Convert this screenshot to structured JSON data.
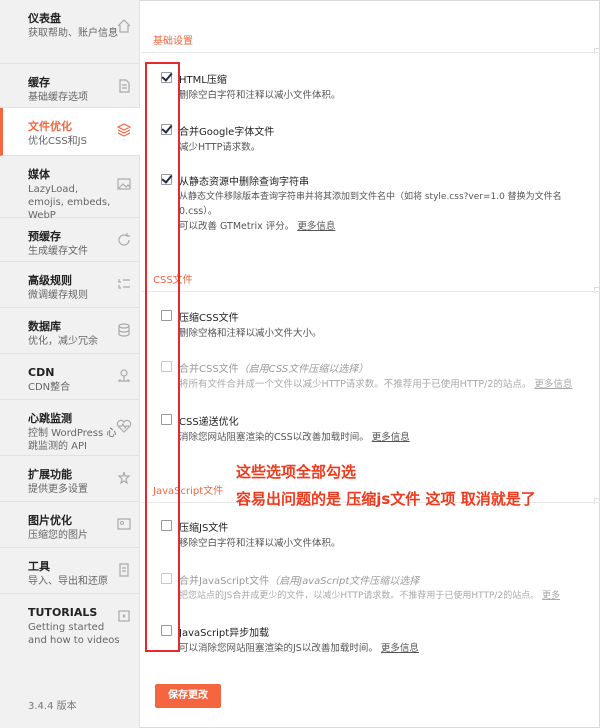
{
  "sidebar": {
    "items": [
      {
        "title": "仪表盘",
        "sub": "获取帮助、账户信息",
        "icon": "home-icon"
      },
      {
        "title": "缓存",
        "sub": "基础缓存选项",
        "icon": "page-icon"
      },
      {
        "title": "文件优化",
        "sub": "优化CSS和JS",
        "icon": "layers-icon",
        "active": true
      },
      {
        "title": "媒体",
        "sub": "LazyLoad, emojis, embeds, WebP",
        "icon": "image-icon"
      },
      {
        "title": "预缓存",
        "sub": "生成缓存文件",
        "icon": "refresh-icon"
      },
      {
        "title": "高级规则",
        "sub": "微调缓存规则",
        "icon": "list-icon"
      },
      {
        "title": "数据库",
        "sub": "优化，减少冗余",
        "icon": "database-icon"
      },
      {
        "title": "CDN",
        "sub": "CDN整合",
        "icon": "cdn-icon"
      },
      {
        "title": "心跳监测",
        "sub": "控制 WordPress 心跳监测的 API",
        "icon": "heart-icon"
      },
      {
        "title": "扩展功能",
        "sub": "提供更多设置",
        "icon": "addon-icon"
      },
      {
        "title": "图片优化",
        "sub": "压缩您的图片",
        "icon": "photo-icon"
      },
      {
        "title": "工具",
        "sub": "导入、导出和还原",
        "icon": "tools-icon"
      },
      {
        "title": "TUTORIALS",
        "sub": "Getting started and how to videos",
        "icon": "video-icon"
      }
    ],
    "version": "3.4.4 版本"
  },
  "sections": {
    "basic": "基础设置",
    "css": "CSS文件",
    "js": "JavaScript文件"
  },
  "options": {
    "html_minify": {
      "title": "HTML压缩",
      "desc": "删除空白字符和注释以减小文件体积。"
    },
    "google_fonts": {
      "title": "合并Google字体文件",
      "desc": "减少HTTP请求数。"
    },
    "query_strings": {
      "title": "从静态资源中删除查询字符串",
      "desc1": "从静态文件移除版本查询字符串并将其添加到文件名中（如将 style.css?ver=1.0 替换为文件名",
      "desc2": "0.css）。",
      "desc3": "可以改善 GTMetrix 评分。",
      "more": "更多信息"
    },
    "css_minify": {
      "title": "压缩CSS文件",
      "desc": "删除空格和注释以减小文件大小。"
    },
    "css_combine": {
      "title": "合并CSS文件",
      "hint": "（启用CSS文件压缩以选择）",
      "desc": "将所有文件合并成一个文件以减少HTTP请求数。不推荐用于已使用HTTP/2的站点。",
      "more": "更多信息"
    },
    "css_async": {
      "title": "CSS递送优化",
      "desc": "消除您网站阻塞渲染的CSS以改善加载时间。",
      "more": "更多信息"
    },
    "js_minify": {
      "title": "压缩JS文件",
      "desc": "移除空白字符和注释以减小文件体积。"
    },
    "js_combine": {
      "title": "合并JavaScript文件",
      "hint": "（启用JavaScript文件压缩以选择",
      "desc": "把您站点的JS合并成更少的文件，以减少HTTP请求数。不推荐用于已使用HTTP/2的站点。",
      "more": "更多"
    },
    "js_defer": {
      "title": "JavaScript异步加载",
      "desc": "可以消除您网站阻塞渲染的JS以改善加载时间。",
      "more": "更多信息"
    }
  },
  "save_label": "保存更改",
  "annotation": {
    "line1": "这些选项全部勾选",
    "line2": "容易出问题的是 压缩js文件 这项 取消就是了"
  },
  "colors": {
    "accent": "#f56640",
    "annotation_red": "#e8282a"
  }
}
